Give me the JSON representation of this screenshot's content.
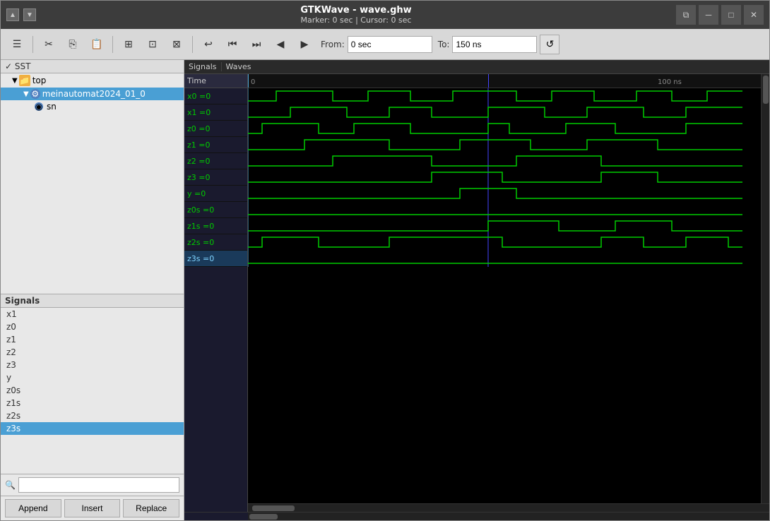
{
  "window": {
    "title": "GTKWave - wave.ghw",
    "subtitle": "Marker: 0 sec  |  Cursor: 0 sec"
  },
  "toolbar": {
    "from_label": "From:",
    "from_value": "0 sec",
    "to_label": "To:",
    "to_value": "150 ns"
  },
  "sst": {
    "label": "✓ SST",
    "tree": [
      {
        "id": "top",
        "label": "top",
        "level": 1,
        "type": "folder",
        "expanded": true
      },
      {
        "id": "meinautomat",
        "label": "meinautomat2024_01_0",
        "level": 2,
        "type": "module",
        "expanded": true,
        "selected": true
      },
      {
        "id": "sn",
        "label": "sn",
        "level": 3,
        "type": "signal"
      }
    ]
  },
  "signals_panel": {
    "header": "Signals",
    "time_header": "Time",
    "items": [
      {
        "id": "x1",
        "label": "x1",
        "selected": false
      },
      {
        "id": "z0",
        "label": "z0",
        "selected": false
      },
      {
        "id": "z1",
        "label": "z1",
        "selected": false
      },
      {
        "id": "z2",
        "label": "z2",
        "selected": false
      },
      {
        "id": "z3",
        "label": "z3",
        "selected": false
      },
      {
        "id": "y",
        "label": "y",
        "selected": false
      },
      {
        "id": "z0s",
        "label": "z0s",
        "selected": false
      },
      {
        "id": "z1s",
        "label": "z1s",
        "selected": false
      },
      {
        "id": "z2s",
        "label": "z2s",
        "selected": false
      },
      {
        "id": "z3s",
        "label": "z3s",
        "selected": true
      }
    ]
  },
  "wave_signals": [
    {
      "id": "x0",
      "label": "x0 =0",
      "selected": false
    },
    {
      "id": "x1",
      "label": "x1 =0",
      "selected": false
    },
    {
      "id": "z0",
      "label": "z0 =0",
      "selected": false
    },
    {
      "id": "z1",
      "label": "z1 =0",
      "selected": false
    },
    {
      "id": "z2",
      "label": "z2 =0",
      "selected": false
    },
    {
      "id": "z3",
      "label": "z3 =0",
      "selected": false
    },
    {
      "id": "y",
      "label": "y =0",
      "selected": false
    },
    {
      "id": "z0s",
      "label": "z0s =0",
      "selected": false
    },
    {
      "id": "z1s",
      "label": "z1s =0",
      "selected": false
    },
    {
      "id": "z2s",
      "label": "z2s =0",
      "selected": false
    },
    {
      "id": "z3s",
      "label": "z3s =0",
      "selected": true
    }
  ],
  "timeline": {
    "marks": [
      "0",
      "100 ns"
    ]
  },
  "buttons": {
    "append": "Append",
    "insert": "Insert",
    "replace": "Replace"
  },
  "search": {
    "placeholder": ""
  }
}
